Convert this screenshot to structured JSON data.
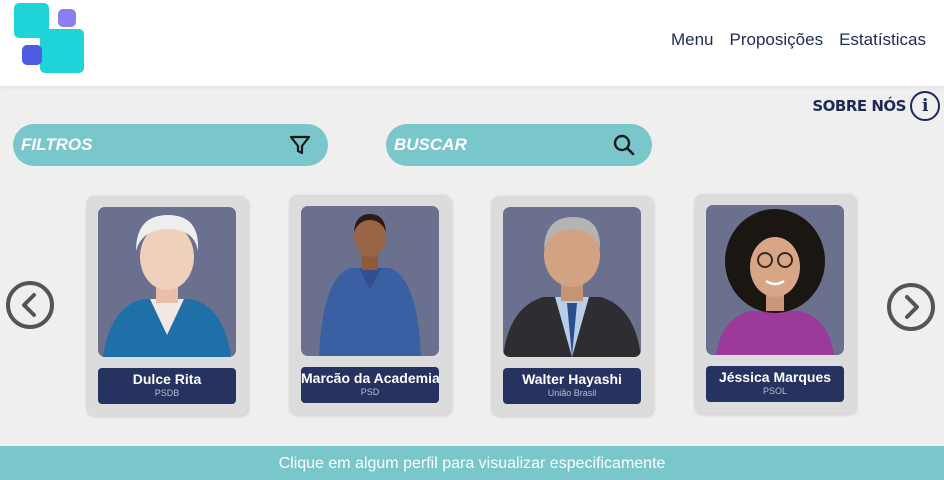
{
  "nav": {
    "items": [
      "Menu",
      "Proposições",
      "Estatísticas"
    ]
  },
  "about": {
    "label": "SOBRE NÓS",
    "icon_glyph": "i"
  },
  "filters": {
    "label": "FILTROS",
    "icon": "filter-icon"
  },
  "search": {
    "label": "BUSCAR",
    "icon": "search-icon"
  },
  "cards": [
    {
      "name": "Dulce Rita",
      "party": "PSDB"
    },
    {
      "name": "Marcão da Academia",
      "party": "PSD"
    },
    {
      "name": "Walter Hayashi",
      "party": "União Brasil"
    },
    {
      "name": "Jéssica Marques",
      "party": "PSOL"
    }
  ],
  "footer": {
    "text": "Clique em algum perfil para visualizar especificamente"
  },
  "colors": {
    "accent": "#79c6cb",
    "navy": "#26325f",
    "logo_teal": "#1fd4d8",
    "logo_purple": "#8a7ff0",
    "logo_blue": "#4c5ce0"
  }
}
